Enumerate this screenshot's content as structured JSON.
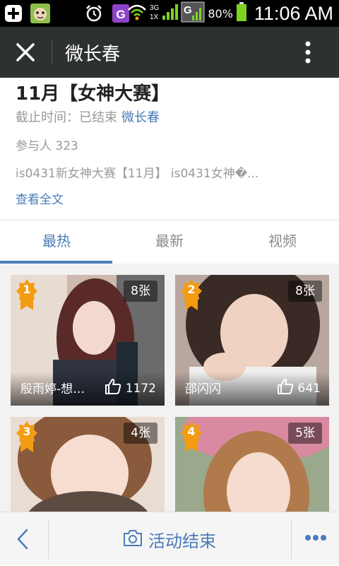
{
  "status_bar": {
    "battery_percent": "80%",
    "time": "11:06 AM",
    "network_badges": [
      "3G",
      "1X"
    ],
    "icons": [
      "add-icon",
      "app-thumbnail-icon",
      "alarm-icon",
      "g-app-icon",
      "wifi-icon",
      "signal-icon",
      "battery-icon"
    ]
  },
  "title_bar": {
    "title": "微长春"
  },
  "activity": {
    "title": "11月【女神大赛】",
    "deadline_label": "截止时间：已结束",
    "organizer": "微长春",
    "participants": "参与人 323",
    "excerpt": "is0431新女神大赛【11月】 is0431女神�...",
    "read_all": "查看全文"
  },
  "tabs": [
    {
      "label": "最热",
      "active": true
    },
    {
      "label": "最新",
      "active": false
    },
    {
      "label": "视频",
      "active": false
    }
  ],
  "entries": [
    {
      "rank": "1",
      "count": "8张",
      "name": "殷雨婷-想…",
      "likes": "1172"
    },
    {
      "rank": "2",
      "count": "8张",
      "name": "邵闪闪",
      "likes": "641"
    },
    {
      "rank": "3",
      "count": "4张",
      "name": "",
      "likes": ""
    },
    {
      "rank": "4",
      "count": "5张",
      "name": "",
      "likes": ""
    }
  ],
  "bottom_bar": {
    "action_label": "活动结束"
  },
  "colors": {
    "accent": "#4a7cb8",
    "title_bar_bg": "#2e3132",
    "rank_badge": "#f39c12",
    "battery": "#7ed321"
  }
}
